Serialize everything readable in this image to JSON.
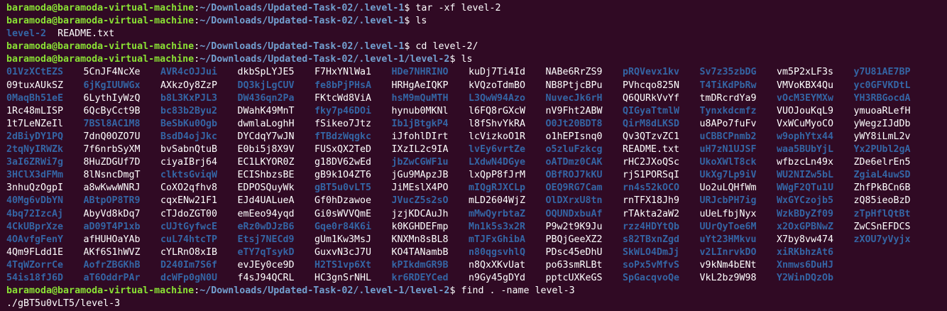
{
  "terminal": {
    "lines": [
      {
        "type": "cmd",
        "user": "baramoda@baramoda-virtual-machine",
        "sep": ":",
        "path": "~/Downloads/Updated-Task-02/.level-1",
        "sym": "$ ",
        "cmd": "tar -xf level-2"
      },
      {
        "type": "cmd",
        "user": "baramoda@baramoda-virtual-machine",
        "sep": ":",
        "path": "~/Downloads/Updated-Task-02/.level-1",
        "sym": "$ ",
        "cmd": "ls"
      },
      {
        "type": "ls",
        "items": [
          {
            "t": "level-2",
            "d": true
          },
          {
            "t": "README.txt",
            "d": false
          }
        ]
      },
      {
        "type": "cmd",
        "user": "baramoda@baramoda-virtual-machine",
        "sep": ":",
        "path": "~/Downloads/Updated-Task-02/.level-1",
        "sym": "$ ",
        "cmd": "cd level-2/"
      },
      {
        "type": "cmd",
        "user": "baramoda@baramoda-virtual-machine",
        "sep": ":",
        "path": "~/Downloads/Updated-Task-02/.level-1/level-2",
        "sym": "$ ",
        "cmd": "ls"
      }
    ],
    "grid": [
      [
        {
          "t": "01VzXCtEZS",
          "d": true
        },
        {
          "t": "5CnJF4NcXe",
          "d": false
        },
        {
          "t": "AVR4cOJJui",
          "d": true
        },
        {
          "t": "dkbSpLYJE5",
          "d": false
        },
        {
          "t": "F7HxYNlWa1",
          "d": false
        },
        {
          "t": "HDe7NHRINO",
          "d": true
        },
        {
          "t": "kuDj7Ti4Id",
          "d": false
        },
        {
          "t": "NABe6RrZS9",
          "d": false
        },
        {
          "t": "pRQVevx1kv",
          "d": true
        },
        {
          "t": "Sv7z35zbDG",
          "d": true
        },
        {
          "t": "vm5P2xLF3s",
          "d": false
        },
        {
          "t": "y7U81AE7BP",
          "d": true
        }
      ],
      [
        {
          "t": "09tuxAUkSZ",
          "d": false
        },
        {
          "t": "6jKgIUUWGx",
          "d": true
        },
        {
          "t": "AXkzOy8ZzP",
          "d": false
        },
        {
          "t": "DQ3kjLgCUV",
          "d": true
        },
        {
          "t": "fe8bPjPHsA",
          "d": true
        },
        {
          "t": "HRHgAeIQKP",
          "d": false
        },
        {
          "t": "kVQzoTdmBO",
          "d": false
        },
        {
          "t": "NB8PtjcBPu",
          "d": false
        },
        {
          "t": "PVhcqo825N",
          "d": false
        },
        {
          "t": "T4TiKdPbRw",
          "d": true
        },
        {
          "t": "VMVoKBX4Qu",
          "d": false
        },
        {
          "t": "yc0GFVKDtL",
          "d": true
        }
      ],
      [
        {
          "t": "0MaqBh51eE",
          "d": true
        },
        {
          "t": "6LythIyWzQ",
          "d": false
        },
        {
          "t": "b8L3KxPJL3",
          "d": true
        },
        {
          "t": "DW436qn2Pa",
          "d": true
        },
        {
          "t": "FKtcWd8ViA",
          "d": false
        },
        {
          "t": "hsM9mQuMTH",
          "d": true
        },
        {
          "t": "L3QwW94Azo",
          "d": true
        },
        {
          "t": "NuvecJk6rH",
          "d": true
        },
        {
          "t": "Q6QURkVvYf",
          "d": false
        },
        {
          "t": "tmDRcrdYa9",
          "d": false
        },
        {
          "t": "vOcM3EYMXw",
          "d": true
        },
        {
          "t": "YH3RBGocdA",
          "d": true
        }
      ],
      [
        {
          "t": "1Rc48mLISP",
          "d": false
        },
        {
          "t": "6QcByCct9B",
          "d": false
        },
        {
          "t": "bc83b2Byu2",
          "d": true
        },
        {
          "t": "DWahK49MnT",
          "d": false
        },
        {
          "t": "fky7p46DOi",
          "d": true
        },
        {
          "t": "hynub0MKNl",
          "d": false
        },
        {
          "t": "l6FQ8rGXcW",
          "d": false
        },
        {
          "t": "nV9Fht2ABW",
          "d": false
        },
        {
          "t": "QIGyaTtmlW",
          "d": true
        },
        {
          "t": "Tynxkdcmfz",
          "d": true
        },
        {
          "t": "VUOJouKqL9",
          "d": false
        },
        {
          "t": "ymuoaRLefH",
          "d": false
        }
      ],
      [
        {
          "t": "1t7LeNZeIl",
          "d": false
        },
        {
          "t": "7BSl8AC1M8",
          "d": true
        },
        {
          "t": "BeSbKu0Ogb",
          "d": true
        },
        {
          "t": "dwmlaLoghH",
          "d": false
        },
        {
          "t": "fSikeo7Jtz",
          "d": false
        },
        {
          "t": "Ib1jBtgkP4",
          "d": true
        },
        {
          "t": "l8fShvYkRA",
          "d": false
        },
        {
          "t": "O0Jt20BDT8",
          "d": true
        },
        {
          "t": "QirM8dLKSD",
          "d": true
        },
        {
          "t": "u8APo7fuFv",
          "d": false
        },
        {
          "t": "VxWCuMyoCO",
          "d": false
        },
        {
          "t": "yWegzIJdDb",
          "d": false
        }
      ],
      [
        {
          "t": "2dBiyDY1PQ",
          "d": true
        },
        {
          "t": "7dnQ0OZO7U",
          "d": false
        },
        {
          "t": "BsdD4ojJkc",
          "d": true
        },
        {
          "t": "DYCdqY7wJN",
          "d": false
        },
        {
          "t": "fTBdzWqgkc",
          "d": true
        },
        {
          "t": "iJfohlDIrt",
          "d": false
        },
        {
          "t": "lcVizkoO1R",
          "d": false
        },
        {
          "t": "o1hEPIsnq0",
          "d": false
        },
        {
          "t": "Qv3QTzvZC1",
          "d": false
        },
        {
          "t": "uCBBCPnmb2",
          "d": true
        },
        {
          "t": "w9ophYtx44",
          "d": true
        },
        {
          "t": "yWY8iLmL2v",
          "d": false
        }
      ],
      [
        {
          "t": "2tqNyIRWZk",
          "d": true
        },
        {
          "t": "7f6nrbSyXM",
          "d": false
        },
        {
          "t": "bvSabnQtuB",
          "d": false
        },
        {
          "t": "E0bi5j8X9V",
          "d": false
        },
        {
          "t": "FUSxQX2TeD",
          "d": false
        },
        {
          "t": "IXzIL2c9IA",
          "d": false
        },
        {
          "t": "lvEy6vrtZe",
          "d": true
        },
        {
          "t": "o5zluFzkcg",
          "d": true
        },
        {
          "t": "README.txt",
          "d": false
        },
        {
          "t": "uH7zN1UJSF",
          "d": true
        },
        {
          "t": "waa5BUbYjL",
          "d": true
        },
        {
          "t": "Yx2PUbl2gA",
          "d": true
        }
      ],
      [
        {
          "t": "3aI6ZRWi7g",
          "d": true
        },
        {
          "t": "8HuZDGUf7D",
          "d": false
        },
        {
          "t": "ciyaIBrj64",
          "d": false
        },
        {
          "t": "EC1LKYOR0Z",
          "d": false
        },
        {
          "t": "g18DV62wEd",
          "d": false
        },
        {
          "t": "jbZwCGWF1u",
          "d": true
        },
        {
          "t": "LXdwN4DGye",
          "d": true
        },
        {
          "t": "oATDmz0CAK",
          "d": true
        },
        {
          "t": "rHC2JXoQSc",
          "d": false
        },
        {
          "t": "UkoXWlT8ck",
          "d": true
        },
        {
          "t": "wfbzcLn49x",
          "d": false
        },
        {
          "t": "ZDe6elrEn5",
          "d": false
        }
      ],
      [
        {
          "t": "3HClX3dFMm",
          "d": true
        },
        {
          "t": "8lNsncDmgT",
          "d": false
        },
        {
          "t": "clktsGviqW",
          "d": true
        },
        {
          "t": "ECIShbzsBE",
          "d": false
        },
        {
          "t": "gB9k1O4ZT6",
          "d": false
        },
        {
          "t": "jGu9MApzJB",
          "d": false
        },
        {
          "t": "lxQpP8fJrM",
          "d": false
        },
        {
          "t": "OBfROJ7kKU",
          "d": true
        },
        {
          "t": "rjS1PORSqI",
          "d": false
        },
        {
          "t": "UkXg7Lp9iV",
          "d": true
        },
        {
          "t": "WU2NIZw5bL",
          "d": true
        },
        {
          "t": "ZgiaL4uwSD",
          "d": true
        }
      ],
      [
        {
          "t": "3nhuQzOgpI",
          "d": false
        },
        {
          "t": "a8wKwwWNRJ",
          "d": false
        },
        {
          "t": "CoXO2qfhv8",
          "d": false
        },
        {
          "t": "EDPOSQuyWk",
          "d": false
        },
        {
          "t": "gBT5u0vLT5",
          "d": true
        },
        {
          "t": "JiMEslX4PO",
          "d": false
        },
        {
          "t": "mIQgRJXCLp",
          "d": true
        },
        {
          "t": "OEQ9RG7Cam",
          "d": true
        },
        {
          "t": "rn4s52kOCO",
          "d": true
        },
        {
          "t": "Uo2uLQHfWm",
          "d": false
        },
        {
          "t": "WWgF2QTu1U",
          "d": true
        },
        {
          "t": "ZhfPkBCn6B",
          "d": false
        }
      ],
      [
        {
          "t": "40Mg6vDbYN",
          "d": true
        },
        {
          "t": "ABtpOP8TR9",
          "d": true
        },
        {
          "t": "cqxENw21F1",
          "d": false
        },
        {
          "t": "EJd4UALueA",
          "d": false
        },
        {
          "t": "Gf0hDzawoe",
          "d": false
        },
        {
          "t": "JVucZ5s2sO",
          "d": true
        },
        {
          "t": "mLD2604WjZ",
          "d": false
        },
        {
          "t": "OlDXrxU8tn",
          "d": true
        },
        {
          "t": "rnTFX18Jh9",
          "d": false
        },
        {
          "t": "URJcbPH7ig",
          "d": true
        },
        {
          "t": "WxGYCzojb5",
          "d": true
        },
        {
          "t": "zQ85ieoBzD",
          "d": false
        }
      ],
      [
        {
          "t": "4bq72IzcAj",
          "d": true
        },
        {
          "t": "AbyVd8kDq7",
          "d": false
        },
        {
          "t": "cTJdoZGT00",
          "d": false
        },
        {
          "t": "emEeo94yqd",
          "d": false
        },
        {
          "t": "Gi0sWVVQmE",
          "d": false
        },
        {
          "t": "jzjKDCAuJh",
          "d": false
        },
        {
          "t": "mMwQyrbtaZ",
          "d": true
        },
        {
          "t": "OQUNDxbuAf",
          "d": true
        },
        {
          "t": "rTAkta2aW2",
          "d": false
        },
        {
          "t": "uUeLfbjNyx",
          "d": false
        },
        {
          "t": "WzkBDyZf09",
          "d": true
        },
        {
          "t": "zTpHflQtBt",
          "d": true
        }
      ],
      [
        {
          "t": "4CkUBprXze",
          "d": true
        },
        {
          "t": "aD09T4P1xb",
          "d": true
        },
        {
          "t": "cUJtGyfwcE",
          "d": true
        },
        {
          "t": "eRz0wDJzB6",
          "d": true
        },
        {
          "t": "Gqe0r84K6i",
          "d": true
        },
        {
          "t": "k0KGHDEFmp",
          "d": false
        },
        {
          "t": "Mn1k5s3x2R",
          "d": true
        },
        {
          "t": "P9w2t9K9Ju",
          "d": false
        },
        {
          "t": "rzz4HDYtQb",
          "d": true
        },
        {
          "t": "UUrQyToe6M",
          "d": true
        },
        {
          "t": "x2OxGPBNwZ",
          "d": true
        },
        {
          "t": "ZwCSnEFDCS",
          "d": false
        }
      ],
      [
        {
          "t": "4OAvfgFenY",
          "d": true
        },
        {
          "t": "afHUHOaYAb",
          "d": false
        },
        {
          "t": "cuL74htcTP",
          "d": true
        },
        {
          "t": "Etsj7NECd9",
          "d": true
        },
        {
          "t": "gUm1Kw3MsJ",
          "d": false
        },
        {
          "t": "KNXMn8sBL8",
          "d": false
        },
        {
          "t": "mTJFxGhibA",
          "d": true
        },
        {
          "t": "PBQjGeeXZ2",
          "d": false
        },
        {
          "t": "s82TBxnZgd",
          "d": true
        },
        {
          "t": "uYt23HMkvu",
          "d": true
        },
        {
          "t": "X7by8vw474",
          "d": false
        },
        {
          "t": "zXOU7yVyjx",
          "d": true
        }
      ],
      [
        {
          "t": "4Qm9FLdd1E",
          "d": false
        },
        {
          "t": "AKf6S1hWVZ",
          "d": false
        },
        {
          "t": "cYLRnO8xIB",
          "d": false
        },
        {
          "t": "eTY7qTsykD",
          "d": true
        },
        {
          "t": "GuxvN3cJ7U",
          "d": false
        },
        {
          "t": "KO4TANambB",
          "d": false
        },
        {
          "t": "n80qgsvhlQ",
          "d": true
        },
        {
          "t": "PDsc45eDhU",
          "d": false
        },
        {
          "t": "SkWLO4DmJj",
          "d": true
        },
        {
          "t": "v2LInrvkDO",
          "d": true
        },
        {
          "t": "xiRKbhzAt6",
          "d": true
        },
        {
          "t": "",
          "d": false
        }
      ],
      [
        {
          "t": "4TqWZorrCe",
          "d": true
        },
        {
          "t": "AofrZBGKhB",
          "d": true
        },
        {
          "t": "D240Im7S6f",
          "d": true
        },
        {
          "t": "evJEy0ce9D",
          "d": false
        },
        {
          "t": "H2TS1vp6Xt",
          "d": true
        },
        {
          "t": "kPIkdmGR9B",
          "d": true
        },
        {
          "t": "n8QxXKvUat",
          "d": false
        },
        {
          "t": "po63smRLBt",
          "d": false
        },
        {
          "t": "soPx5vMfvS",
          "d": true
        },
        {
          "t": "v9kNm4bENt",
          "d": false
        },
        {
          "t": "Xnmws6DuHJ",
          "d": true
        },
        {
          "t": "",
          "d": false
        }
      ],
      [
        {
          "t": "54is18fJ6D",
          "d": true
        },
        {
          "t": "aT6OddrPAr",
          "d": true
        },
        {
          "t": "dcWFp0gN0U",
          "d": true
        },
        {
          "t": "f4sJ94QCRL",
          "d": false
        },
        {
          "t": "HC3gnSrNHL",
          "d": false
        },
        {
          "t": "kr6RDEYCed",
          "d": true
        },
        {
          "t": "n9Gy45gDYd",
          "d": false
        },
        {
          "t": "pptcUXKeGS",
          "d": false
        },
        {
          "t": "SpGacqvoQe",
          "d": true
        },
        {
          "t": "VkL2bz9W98",
          "d": false
        },
        {
          "t": "Y2WinDQzOb",
          "d": true
        },
        {
          "t": "",
          "d": false
        }
      ]
    ],
    "after": [
      {
        "type": "cmd",
        "user": "baramoda@baramoda-virtual-machine",
        "sep": ":",
        "path": "~/Downloads/Updated-Task-02/.level-1/level-2",
        "sym": "$ ",
        "cmd": "find . -name level-3"
      },
      {
        "type": "out",
        "text": "./gBT5u0vLT5/level-3"
      }
    ]
  },
  "colors": {
    "background": "#300a24",
    "prompt_user": "#8ae234",
    "prompt_path": "#729fcf",
    "directory": "#3465a4",
    "text": "#ffffff"
  }
}
